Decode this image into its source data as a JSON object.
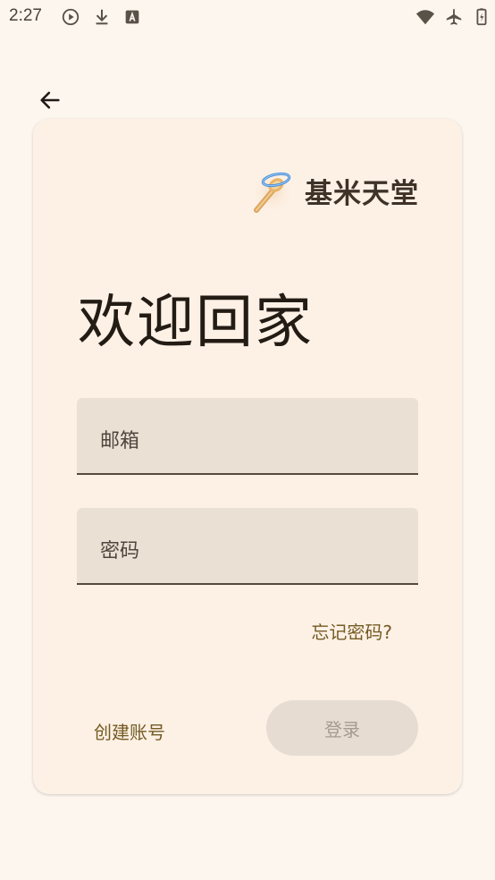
{
  "status_bar": {
    "time": "2:27"
  },
  "brand": {
    "name": "基米天堂"
  },
  "welcome_title": "欢迎回家",
  "email": {
    "placeholder": "邮箱"
  },
  "password": {
    "placeholder": "密码"
  },
  "forgot_password": "忘记密码?",
  "create_account": "创建账号",
  "login_button": "登录",
  "colors": {
    "background": "#fdf6ef",
    "card": "#fdf1e6",
    "field": "#eae0d4",
    "link": "#745a22",
    "button_disabled": "#e6dcd1"
  }
}
